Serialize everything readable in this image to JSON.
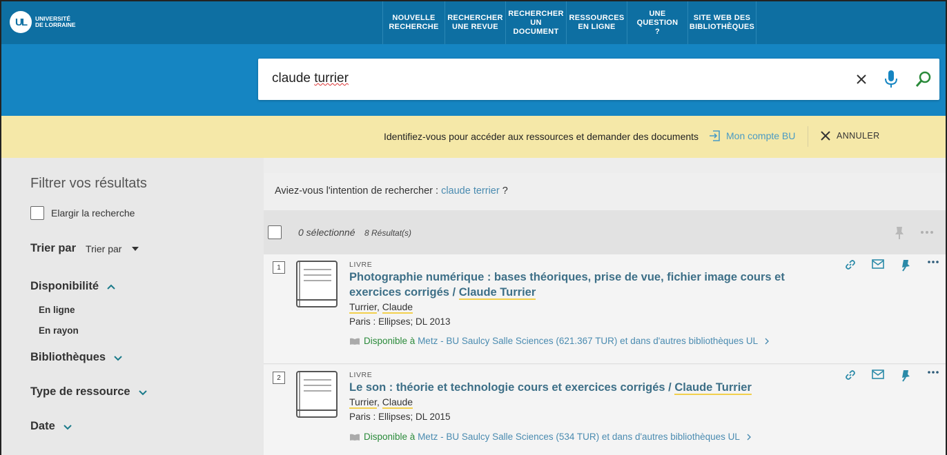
{
  "header": {
    "logo_mark": "UL",
    "logo_line1": "UNIVERSITÉ",
    "logo_line2": "DE LORRAINE",
    "nav": [
      {
        "label": "NOUVELLE RECHERCHE"
      },
      {
        "label": "RECHERCHER UNE REVUE"
      },
      {
        "label": "RECHERCHER UN DOCUMENT"
      },
      {
        "label": "RESSOURCES EN LIGNE"
      },
      {
        "label": "UNE QUESTION ?"
      },
      {
        "label": "SITE WEB DES BIBLIOTHÈQUES"
      }
    ]
  },
  "search": {
    "query_word1": "claude",
    "query_word2": "turrier"
  },
  "notice": {
    "text": "Identifiez-vous pour accéder aux ressources et demander des documents",
    "account": "Mon compte BU",
    "cancel": "ANNULER"
  },
  "filters": {
    "title": "Filtrer vos résultats",
    "elargir": "Elargir la recherche",
    "sort_label": "Trier par",
    "sort_value": "Trier par",
    "disponibilite": "Disponibilité",
    "en_ligne": "En ligne",
    "en_rayon": "En rayon",
    "bibliotheques": "Bibliothèques",
    "type_ressource": "Type de ressource",
    "date": "Date"
  },
  "results": {
    "didyou_prefix": "Aviez-vous l'intention de rechercher :",
    "didyou_link": "claude terrier",
    "didyou_suffix": "?",
    "selected": "0 sélectionné",
    "count": "8 Résultat(s)",
    "items": [
      {
        "num": "1",
        "type": "LIVRE",
        "title_main": "Photographie numérique : bases théoriques, prise de vue, fichier image cours et exercices corrigés / ",
        "title_author": "Claude Turrier",
        "author_last": "Turrier",
        "author_first": "Claude",
        "pub": "Paris : Ellipses; DL 2013",
        "avail": "Disponible à",
        "location": "Metz - BU Saulcy  Salle Sciences (621.367 TUR) et dans d'autres bibliothèques UL"
      },
      {
        "num": "2",
        "type": "LIVRE",
        "title_main": "Le son : théorie et technologie cours et exercices corrigés / ",
        "title_author": "Claude Turrier",
        "author_last": "Turrier",
        "author_first": "Claude",
        "pub": "Paris : Ellipses; DL 2015",
        "avail": "Disponible à",
        "location": "Metz - BU Saulcy  Salle Sciences (534 TUR) et dans d'autres bibliothèques UL"
      }
    ]
  },
  "colors": {
    "topbar": "#0e6fa2",
    "search_band": "#1585c2",
    "notice": "#f5e8a8",
    "title_link": "#3d6f87",
    "available": "#2a8a3a",
    "icon_teal": "#2b8aa8"
  }
}
